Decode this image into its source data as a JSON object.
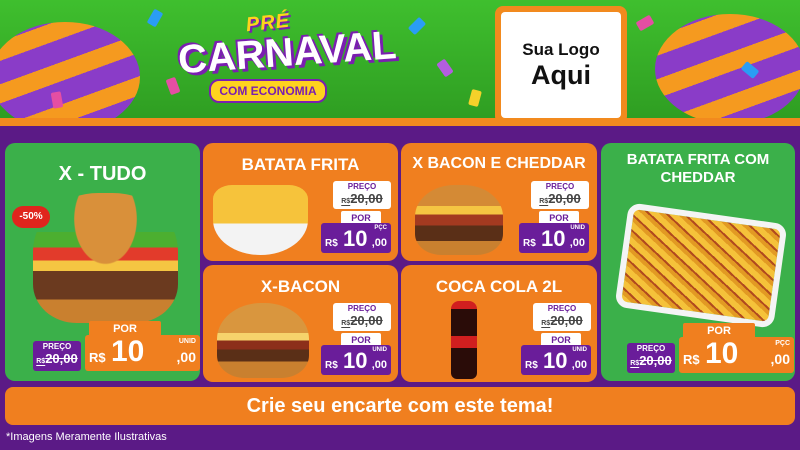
{
  "header": {
    "title_pre": "PRÉ",
    "title_main": "CARNAVAL",
    "title_sub": "COM ECONOMIA",
    "logo_line1": "Sua Logo",
    "logo_line2": "Aqui"
  },
  "colors": {
    "header_green": "#3fbf2e",
    "background_purple": "#5b1a86",
    "card_green": "#3bb04a",
    "card_orange": "#f07f1f",
    "price_purple": "#6a1d9a"
  },
  "products": [
    {
      "title": "X - TUDO",
      "badge": "-50%",
      "preco_label": "PREÇO",
      "old_currency": "R$",
      "old_price": "20,00",
      "por_label": "POR",
      "currency": "R$",
      "price_int": "10",
      "price_cents": ",00",
      "unit": "UNID"
    },
    {
      "title": "BATATA FRITA",
      "preco_label": "PREÇO",
      "old_currency": "R$",
      "old_price": "20,00",
      "por_label": "POR",
      "currency": "R$",
      "price_int": "10",
      "price_cents": ",00",
      "unit": "PÇC"
    },
    {
      "title": "X BACON E CHEDDAR",
      "preco_label": "PREÇO",
      "old_currency": "R$",
      "old_price": "20,00",
      "por_label": "POR",
      "currency": "R$",
      "price_int": "10",
      "price_cents": ",00",
      "unit": "UNID"
    },
    {
      "title": "BATATA FRITA COM CHEDDAR",
      "preco_label": "PREÇO",
      "old_currency": "R$",
      "old_price": "20,00",
      "por_label": "POR",
      "currency": "R$",
      "price_int": "10",
      "price_cents": ",00",
      "unit": "PÇC"
    },
    {
      "title": "X-BACON",
      "preco_label": "PREÇO",
      "old_currency": "R$",
      "old_price": "20,00",
      "por_label": "POR",
      "currency": "R$",
      "price_int": "10",
      "price_cents": ",00",
      "unit": "UNID"
    },
    {
      "title": "COCA COLA 2L",
      "preco_label": "PREÇO",
      "old_currency": "R$",
      "old_price": "20,00",
      "por_label": "POR",
      "currency": "R$",
      "price_int": "10",
      "price_cents": ",00",
      "unit": "UNID"
    }
  ],
  "cta": "Crie seu encarte com este tema!",
  "footnote": "*Imagens Meramente Ilustrativas"
}
